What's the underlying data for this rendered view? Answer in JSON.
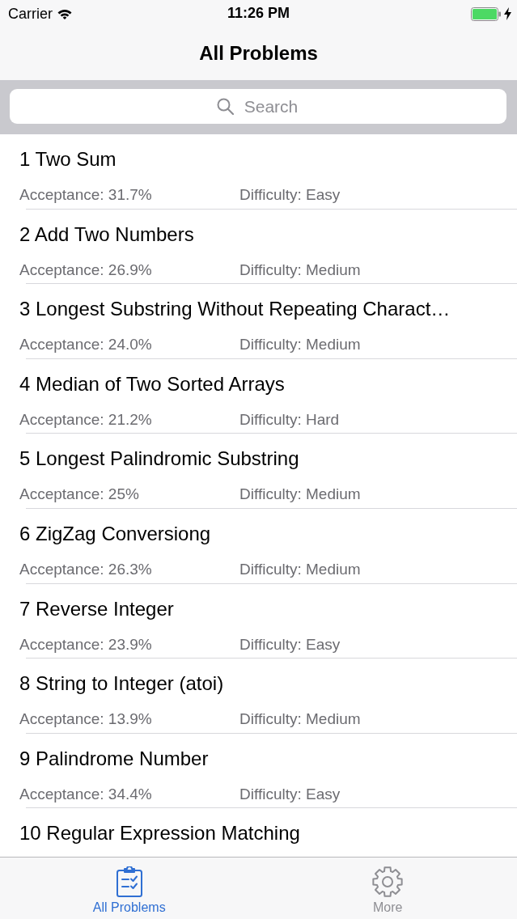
{
  "status_bar": {
    "carrier": "Carrier",
    "time": "11:26 PM"
  },
  "nav_bar": {
    "title": "All Problems"
  },
  "search": {
    "placeholder": "Search"
  },
  "problems": [
    {
      "title": "1 Two Sum",
      "acceptance": "Acceptance: 31.7%",
      "difficulty": "Difficulty: Easy"
    },
    {
      "title": "2 Add Two Numbers",
      "acceptance": "Acceptance: 26.9%",
      "difficulty": "Difficulty: Medium"
    },
    {
      "title": "3 Longest Substring Without Repeating Charact…",
      "acceptance": "Acceptance: 24.0%",
      "difficulty": "Difficulty: Medium"
    },
    {
      "title": "4 Median of Two Sorted Arrays",
      "acceptance": "Acceptance: 21.2%",
      "difficulty": "Difficulty: Hard"
    },
    {
      "title": "5 Longest Palindromic Substring",
      "acceptance": "Acceptance: 25%",
      "difficulty": "Difficulty: Medium"
    },
    {
      "title": "6 ZigZag Conversiong",
      "acceptance": "Acceptance: 26.3%",
      "difficulty": "Difficulty: Medium"
    },
    {
      "title": "7 Reverse Integer",
      "acceptance": "Acceptance: 23.9%",
      "difficulty": "Difficulty: Easy"
    },
    {
      "title": "8 String to Integer (atoi)",
      "acceptance": "Acceptance: 13.9%",
      "difficulty": "Difficulty: Medium"
    },
    {
      "title": "9 Palindrome Number",
      "acceptance": "Acceptance: 34.4%",
      "difficulty": "Difficulty: Easy"
    },
    {
      "title": "10 Regular Expression Matching"
    }
  ],
  "tab_bar": {
    "tabs": [
      {
        "label": "All Problems",
        "selected": true
      },
      {
        "label": "More",
        "selected": false
      }
    ]
  }
}
